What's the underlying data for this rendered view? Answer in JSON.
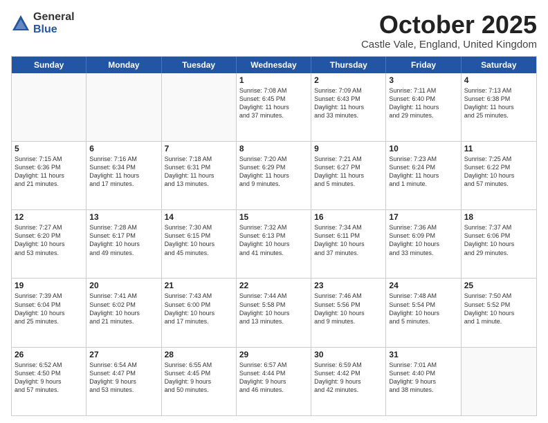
{
  "logo": {
    "general": "General",
    "blue": "Blue"
  },
  "title": "October 2025",
  "location": "Castle Vale, England, United Kingdom",
  "headers": [
    "Sunday",
    "Monday",
    "Tuesday",
    "Wednesday",
    "Thursday",
    "Friday",
    "Saturday"
  ],
  "weeks": [
    [
      {
        "day": "",
        "lines": []
      },
      {
        "day": "",
        "lines": []
      },
      {
        "day": "",
        "lines": []
      },
      {
        "day": "1",
        "lines": [
          "Sunrise: 7:08 AM",
          "Sunset: 6:45 PM",
          "Daylight: 11 hours",
          "and 37 minutes."
        ]
      },
      {
        "day": "2",
        "lines": [
          "Sunrise: 7:09 AM",
          "Sunset: 6:43 PM",
          "Daylight: 11 hours",
          "and 33 minutes."
        ]
      },
      {
        "day": "3",
        "lines": [
          "Sunrise: 7:11 AM",
          "Sunset: 6:40 PM",
          "Daylight: 11 hours",
          "and 29 minutes."
        ]
      },
      {
        "day": "4",
        "lines": [
          "Sunrise: 7:13 AM",
          "Sunset: 6:38 PM",
          "Daylight: 11 hours",
          "and 25 minutes."
        ]
      }
    ],
    [
      {
        "day": "5",
        "lines": [
          "Sunrise: 7:15 AM",
          "Sunset: 6:36 PM",
          "Daylight: 11 hours",
          "and 21 minutes."
        ]
      },
      {
        "day": "6",
        "lines": [
          "Sunrise: 7:16 AM",
          "Sunset: 6:34 PM",
          "Daylight: 11 hours",
          "and 17 minutes."
        ]
      },
      {
        "day": "7",
        "lines": [
          "Sunrise: 7:18 AM",
          "Sunset: 6:31 PM",
          "Daylight: 11 hours",
          "and 13 minutes."
        ]
      },
      {
        "day": "8",
        "lines": [
          "Sunrise: 7:20 AM",
          "Sunset: 6:29 PM",
          "Daylight: 11 hours",
          "and 9 minutes."
        ]
      },
      {
        "day": "9",
        "lines": [
          "Sunrise: 7:21 AM",
          "Sunset: 6:27 PM",
          "Daylight: 11 hours",
          "and 5 minutes."
        ]
      },
      {
        "day": "10",
        "lines": [
          "Sunrise: 7:23 AM",
          "Sunset: 6:24 PM",
          "Daylight: 11 hours",
          "and 1 minute."
        ]
      },
      {
        "day": "11",
        "lines": [
          "Sunrise: 7:25 AM",
          "Sunset: 6:22 PM",
          "Daylight: 10 hours",
          "and 57 minutes."
        ]
      }
    ],
    [
      {
        "day": "12",
        "lines": [
          "Sunrise: 7:27 AM",
          "Sunset: 6:20 PM",
          "Daylight: 10 hours",
          "and 53 minutes."
        ]
      },
      {
        "day": "13",
        "lines": [
          "Sunrise: 7:28 AM",
          "Sunset: 6:17 PM",
          "Daylight: 10 hours",
          "and 49 minutes."
        ]
      },
      {
        "day": "14",
        "lines": [
          "Sunrise: 7:30 AM",
          "Sunset: 6:15 PM",
          "Daylight: 10 hours",
          "and 45 minutes."
        ]
      },
      {
        "day": "15",
        "lines": [
          "Sunrise: 7:32 AM",
          "Sunset: 6:13 PM",
          "Daylight: 10 hours",
          "and 41 minutes."
        ]
      },
      {
        "day": "16",
        "lines": [
          "Sunrise: 7:34 AM",
          "Sunset: 6:11 PM",
          "Daylight: 10 hours",
          "and 37 minutes."
        ]
      },
      {
        "day": "17",
        "lines": [
          "Sunrise: 7:36 AM",
          "Sunset: 6:09 PM",
          "Daylight: 10 hours",
          "and 33 minutes."
        ]
      },
      {
        "day": "18",
        "lines": [
          "Sunrise: 7:37 AM",
          "Sunset: 6:06 PM",
          "Daylight: 10 hours",
          "and 29 minutes."
        ]
      }
    ],
    [
      {
        "day": "19",
        "lines": [
          "Sunrise: 7:39 AM",
          "Sunset: 6:04 PM",
          "Daylight: 10 hours",
          "and 25 minutes."
        ]
      },
      {
        "day": "20",
        "lines": [
          "Sunrise: 7:41 AM",
          "Sunset: 6:02 PM",
          "Daylight: 10 hours",
          "and 21 minutes."
        ]
      },
      {
        "day": "21",
        "lines": [
          "Sunrise: 7:43 AM",
          "Sunset: 6:00 PM",
          "Daylight: 10 hours",
          "and 17 minutes."
        ]
      },
      {
        "day": "22",
        "lines": [
          "Sunrise: 7:44 AM",
          "Sunset: 5:58 PM",
          "Daylight: 10 hours",
          "and 13 minutes."
        ]
      },
      {
        "day": "23",
        "lines": [
          "Sunrise: 7:46 AM",
          "Sunset: 5:56 PM",
          "Daylight: 10 hours",
          "and 9 minutes."
        ]
      },
      {
        "day": "24",
        "lines": [
          "Sunrise: 7:48 AM",
          "Sunset: 5:54 PM",
          "Daylight: 10 hours",
          "and 5 minutes."
        ]
      },
      {
        "day": "25",
        "lines": [
          "Sunrise: 7:50 AM",
          "Sunset: 5:52 PM",
          "Daylight: 10 hours",
          "and 1 minute."
        ]
      }
    ],
    [
      {
        "day": "26",
        "lines": [
          "Sunrise: 6:52 AM",
          "Sunset: 4:50 PM",
          "Daylight: 9 hours",
          "and 57 minutes."
        ]
      },
      {
        "day": "27",
        "lines": [
          "Sunrise: 6:54 AM",
          "Sunset: 4:47 PM",
          "Daylight: 9 hours",
          "and 53 minutes."
        ]
      },
      {
        "day": "28",
        "lines": [
          "Sunrise: 6:55 AM",
          "Sunset: 4:45 PM",
          "Daylight: 9 hours",
          "and 50 minutes."
        ]
      },
      {
        "day": "29",
        "lines": [
          "Sunrise: 6:57 AM",
          "Sunset: 4:44 PM",
          "Daylight: 9 hours",
          "and 46 minutes."
        ]
      },
      {
        "day": "30",
        "lines": [
          "Sunrise: 6:59 AM",
          "Sunset: 4:42 PM",
          "Daylight: 9 hours",
          "and 42 minutes."
        ]
      },
      {
        "day": "31",
        "lines": [
          "Sunrise: 7:01 AM",
          "Sunset: 4:40 PM",
          "Daylight: 9 hours",
          "and 38 minutes."
        ]
      },
      {
        "day": "",
        "lines": []
      }
    ]
  ]
}
